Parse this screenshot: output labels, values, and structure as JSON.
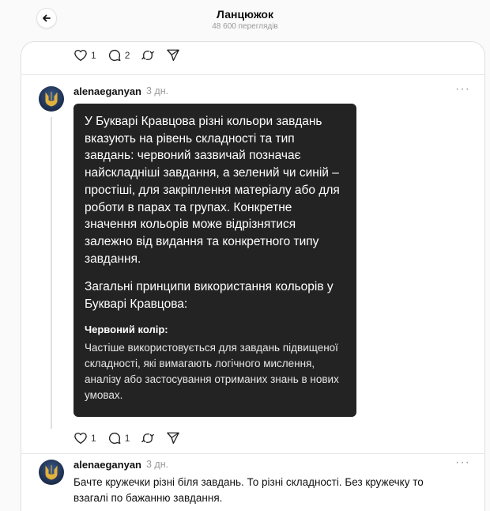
{
  "header": {
    "title": "Ланцюжок",
    "views": "48 600 переглядів"
  },
  "top_actions": {
    "likes": "1",
    "comments": "2"
  },
  "post1": {
    "username": "alenaeganyan",
    "time": "3 дн.",
    "bubble": {
      "paragraph": "У Букварі Кравцова різні кольори завдань вказують на рівень складності та тип завдань: червоний зазвичай позначає найскладніші завдання, а зелений чи синій – простіші, для закріплення матеріалу або для роботи в парах та групах. Конкретне значення кольорів може відрізнятися залежно від видання та конкретного типу завдання.",
      "heading": "Загальні принципи використання кольорів у Букварі Кравцова:",
      "subheading": "Червоний колір:",
      "detail": "Частіше використовується для завдань підвищеної складності, які вимагають логічного мислення, аналізу або застосування отриманих знань в нових умовах."
    },
    "likes": "1",
    "comments": "1"
  },
  "post2": {
    "username": "alenaeganyan",
    "time": "3 дн.",
    "text": "Бачте кружечки різні біля завдань. То різні складності. Без кружечку то взагалі по бажанню завдання."
  },
  "icons": {
    "back": "arrow-left-icon",
    "like": "heart-icon",
    "comment": "comment-bubble-icon",
    "repost": "repost-icon",
    "share": "send-icon",
    "more": "more-dots-icon"
  },
  "colors": {
    "background": "#fafafa",
    "card": "#ffffff",
    "bubble": "#232323",
    "muted": "#999999"
  }
}
